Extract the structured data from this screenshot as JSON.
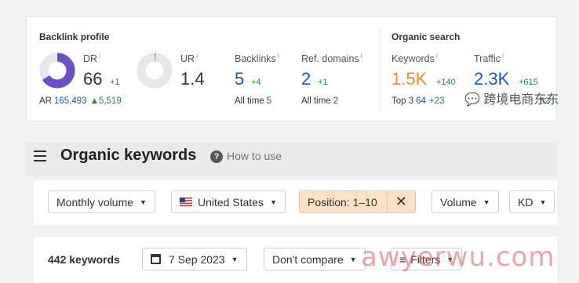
{
  "backlink_profile": {
    "title": "Backlink profile",
    "dr": {
      "label": "DR",
      "info": "i",
      "value": "66",
      "delta": "+1",
      "fill_fraction": 0.66,
      "color": "#6b4fc8"
    },
    "ar": {
      "label": "AR",
      "value": "165,493",
      "delta": "▲5,519"
    },
    "ur": {
      "label": "UR",
      "info": "i",
      "value": "1.4",
      "fill_fraction": 0.014,
      "color": "#8bc34a"
    },
    "backlinks": {
      "label": "Backlinks",
      "info": "i",
      "value": "5",
      "delta": "+4",
      "all_time_label": "All time",
      "all_time_value": "5"
    },
    "ref_domains": {
      "label": "Ref. domains",
      "info": "i",
      "value": "2",
      "delta": "+1",
      "all_time_label": "All time",
      "all_time_value": "2"
    }
  },
  "organic_search": {
    "title": "Organic search",
    "keywords": {
      "label": "Keywords",
      "info": "i",
      "value": "1.5K",
      "delta": "+140",
      "top3_label": "Top 3",
      "top3_value": "64",
      "top3_delta": "+23"
    },
    "traffic": {
      "label": "Traffic",
      "info": "i",
      "value": "2.3K",
      "delta": "+615",
      "sub_delta": "52"
    }
  },
  "header": {
    "title": "Organic keywords",
    "help_icon": "question-circle-icon",
    "help_text": "How to use"
  },
  "filters": {
    "volume": "Monthly volume",
    "country": "United States",
    "position": "Position: 1–10",
    "position_clear": "✕",
    "volume_filter": "Volume",
    "kd": "KD"
  },
  "results": {
    "count": "442 keywords",
    "date": "7 Sep 2023",
    "compare": "Don't compare",
    "filters": "Filters"
  },
  "watermarks": {
    "wechat": "跨境电商东东",
    "site": "awyerwu.com"
  }
}
